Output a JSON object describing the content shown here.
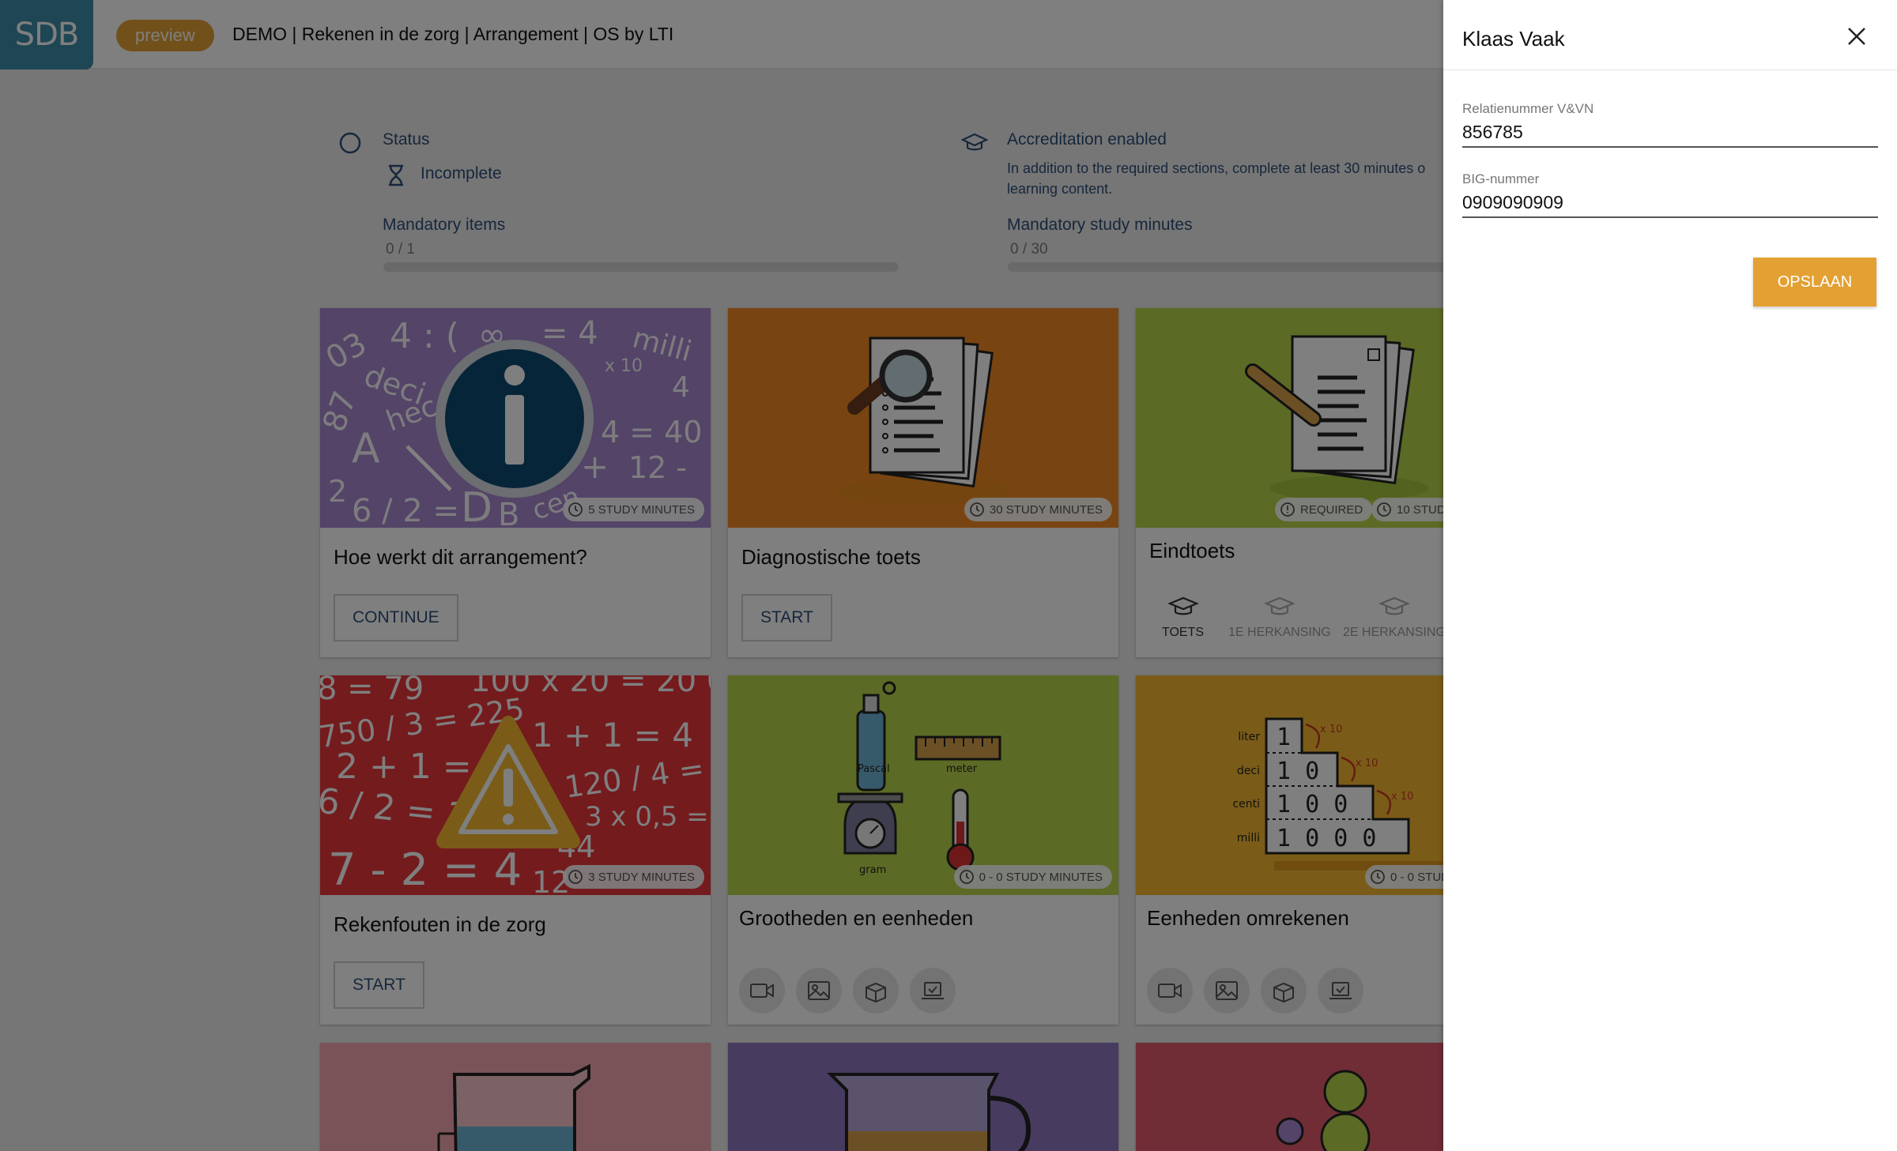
{
  "topbar": {
    "logo_text": "SDB",
    "preview_label": "preview",
    "title": "DEMO | Rekenen in de zorg | Arrangement | OS by LTI"
  },
  "summary": {
    "status_label": "Status",
    "status_value": "Incomplete",
    "mandatory_items_label": "Mandatory items",
    "mandatory_items_value": "0 / 1",
    "mandatory_items_progress": 0,
    "accreditation_label": "Accreditation enabled",
    "accreditation_text_1": "In addition to the required sections, complete at least 30 minutes o",
    "accreditation_text_2": "learning content.",
    "study_minutes_label": "Mandatory study minutes",
    "study_minutes_value": "0 / 30",
    "study_minutes_progress": 0
  },
  "cards": [
    {
      "title": "Hoe werkt dit arrangement?",
      "badge": "5 STUDY MINUTES",
      "button": "CONTINUE",
      "color": "#a788d1"
    },
    {
      "title": "Diagnostische toets",
      "badge": "30 STUDY MINUTES",
      "button": "START",
      "color": "#f08a24"
    },
    {
      "title": "Eindtoets",
      "required": "REQUIRED",
      "badge": "10 STUD",
      "color": "#b6d54a",
      "tabs": [
        "TOETS",
        "1E HERKANSING",
        "2E HERKANSING"
      ]
    },
    {
      "title": "Rekenfouten in de zorg",
      "badge": "3 STUDY MINUTES",
      "button": "START",
      "color": "#e8373a"
    },
    {
      "title": "Grootheden en eenheden",
      "badge": "0 - 0 STUDY MINUTES",
      "color": "#b6d54a",
      "labels": [
        "Pascal",
        "meter",
        "gram"
      ]
    },
    {
      "title": "Eenheden omrekenen",
      "badge": "0 - 0 STUD",
      "color": "#f5b831",
      "rows": [
        "liter",
        "deci",
        "centi",
        "milli"
      ],
      "digits": [
        "1",
        "1 0",
        "1 0 0",
        "1 0 0 0"
      ],
      "factor": "x 10"
    }
  ],
  "bottom_cards_colors": [
    "#f4a6b0",
    "#8f77c0",
    "#e05a6c"
  ],
  "resource_icons": [
    "video-icon",
    "image-icon",
    "box-icon",
    "laptop-icon"
  ],
  "panel": {
    "title": "Klaas Vaak",
    "field1_label": "Relatienummer V&VN",
    "field1_value": "856785",
    "field2_label": "BIG-nummer",
    "field2_value": "0909090909",
    "save_label": "OPSLAAN"
  }
}
